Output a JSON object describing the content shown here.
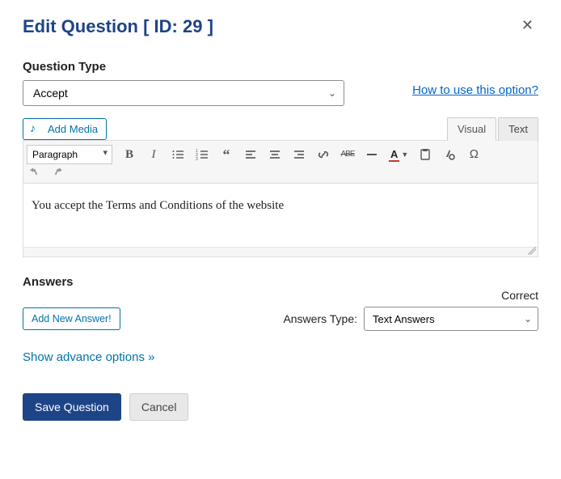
{
  "title": "Edit Question [ ID: 29 ]",
  "question_type": {
    "label": "Question Type",
    "value": "Accept",
    "howto": "How to use this option?"
  },
  "media_button": "Add Media",
  "editor": {
    "tabs": {
      "visual": "Visual",
      "text": "Text",
      "active": "visual"
    },
    "format": "Paragraph",
    "content": "You accept the Terms and Conditions of the website"
  },
  "answers": {
    "heading": "Answers",
    "correct_label": "Correct",
    "add_button": "Add New Answer!",
    "type_label": "Answers Type:",
    "type_value": "Text Answers"
  },
  "advanced_link": "Show advance options »",
  "actions": {
    "save": "Save Question",
    "cancel": "Cancel"
  }
}
